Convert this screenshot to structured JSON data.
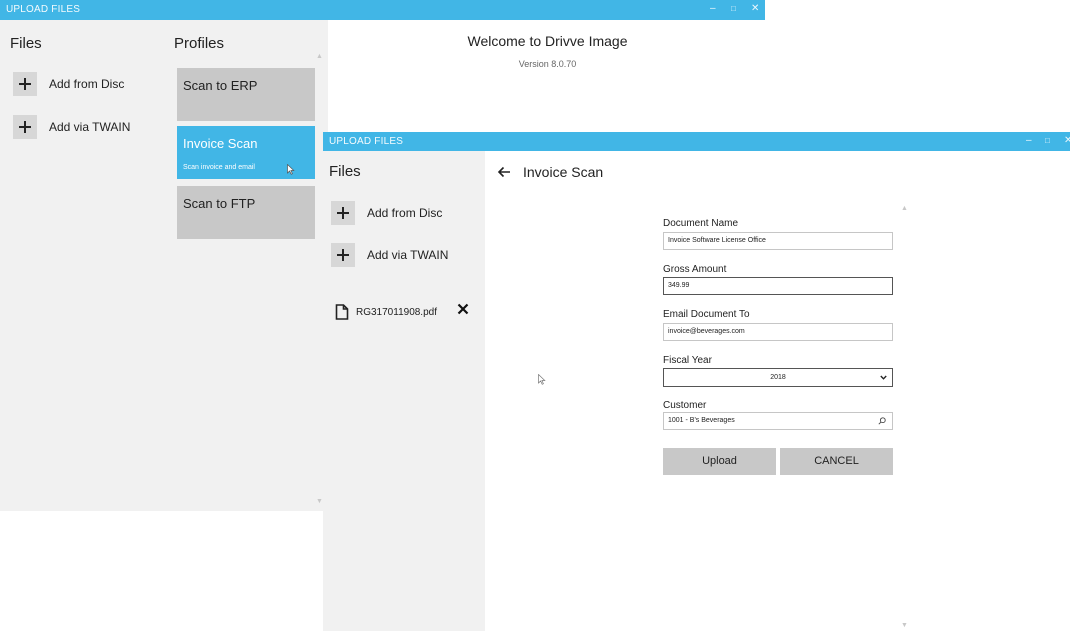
{
  "window1": {
    "title": "UPLOAD FILES",
    "controls": {
      "minimize": "–",
      "maximize": "□",
      "close": "✕"
    },
    "files_heading": "Files",
    "add_from_disc": "Add from Disc",
    "add_via_twain": "Add via TWAIN",
    "profiles_heading": "Profiles",
    "profiles": [
      {
        "title": "Scan to ERP",
        "subtitle": "",
        "active": false
      },
      {
        "title": "Invoice Scan",
        "subtitle": "Scan invoice and email",
        "active": true
      },
      {
        "title": "Scan to FTP",
        "subtitle": "",
        "active": false
      }
    ],
    "welcome": "Welcome to Drivve Image",
    "version": "Version 8.0.70"
  },
  "window2": {
    "title": "UPLOAD FILES",
    "controls": {
      "minimize": "–",
      "maximize": "□",
      "close": "✕"
    },
    "files_heading": "Files",
    "add_from_disc": "Add from Disc",
    "add_via_twain": "Add via TWAIN",
    "file_name": "RG317011908.pdf",
    "page_title": "Invoice Scan",
    "form": {
      "document_name_label": "Document Name",
      "document_name_value": "Invoice Software License Office",
      "gross_amount_label": "Gross Amount",
      "gross_amount_value": "349.99",
      "email_label": "Email Document To",
      "email_value": "invoice@beverages.com",
      "fiscal_year_label": "Fiscal Year",
      "fiscal_year_value": "2018",
      "customer_label": "Customer",
      "customer_value": "1001 - B's Beverages"
    },
    "upload_button": "Upload",
    "cancel_button": "CANCEL"
  },
  "colors": {
    "accent": "#41b6e6",
    "pane_bg": "#f1f1f1",
    "card_bg": "#c8c8c8",
    "button_bg": "#c8c8c8"
  },
  "icons": [
    "plus-icon",
    "file-icon",
    "close-icon",
    "back-arrow-icon",
    "chevron-down-icon",
    "search-icon",
    "mouse-cursor-icon"
  ]
}
